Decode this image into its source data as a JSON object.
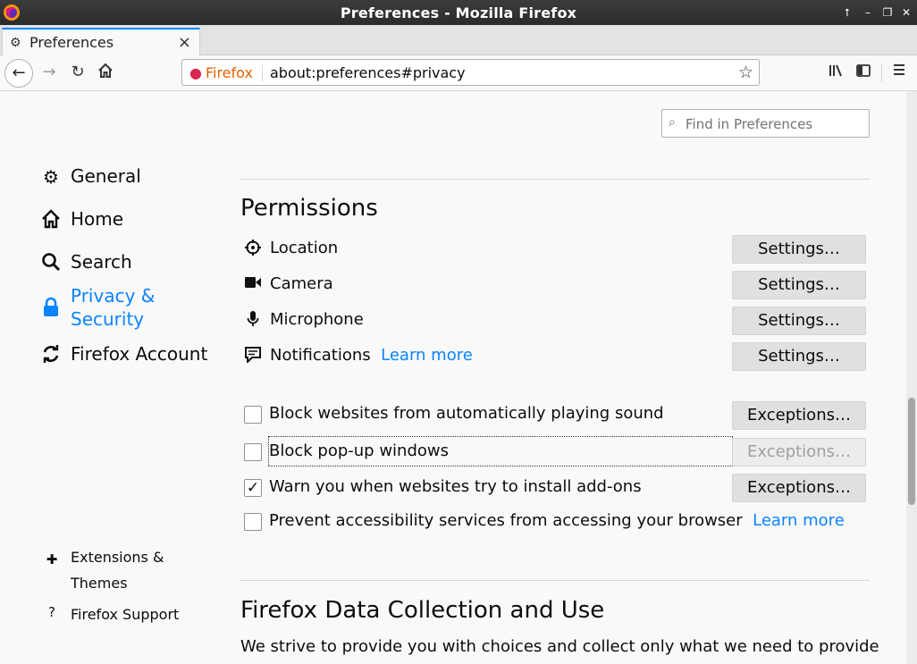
{
  "window": {
    "title": "Preferences - Mozilla Firefox"
  },
  "tabs": [
    {
      "label": "Preferences"
    }
  ],
  "toolbar": {
    "identity": "Firefox",
    "url": "about:preferences#privacy"
  },
  "search": {
    "placeholder": "Find in Preferences"
  },
  "sidebar": {
    "categories": [
      {
        "label": "General",
        "icon": "gear-icon"
      },
      {
        "label": "Home",
        "icon": "home-icon"
      },
      {
        "label": "Search",
        "icon": "search-icon"
      },
      {
        "label": "Privacy & Security",
        "icon": "lock-icon",
        "selected": true
      },
      {
        "label": "Firefox Account",
        "icon": "sync-icon"
      }
    ],
    "footer": [
      {
        "label": "Extensions & Themes",
        "icon": "puzzle-icon"
      },
      {
        "label": "Firefox Support",
        "icon": "help-icon"
      }
    ]
  },
  "permissions": {
    "heading": "Permissions",
    "items": [
      {
        "label": "Location",
        "icon": "location-icon",
        "button": "Settings…"
      },
      {
        "label": "Camera",
        "icon": "camera-icon",
        "button": "Settings…"
      },
      {
        "label": "Microphone",
        "icon": "microphone-icon",
        "button": "Settings…"
      },
      {
        "label": "Notifications",
        "icon": "notification-icon",
        "learn_more": "Learn more",
        "button": "Settings…"
      }
    ],
    "checkboxes": [
      {
        "label": "Block websites from automatically playing sound",
        "checked": false,
        "button": "Exceptions…",
        "button_enabled": true
      },
      {
        "label": "Block pop-up windows",
        "checked": false,
        "button": "Exceptions…",
        "button_enabled": false
      },
      {
        "label": "Warn you when websites try to install add-ons",
        "checked": true,
        "button": "Exceptions…",
        "button_enabled": true
      },
      {
        "label": "Prevent accessibility services from accessing your browser",
        "checked": false,
        "learn_more": "Learn more"
      }
    ]
  },
  "data_collection": {
    "heading": "Firefox Data Collection and Use",
    "intro": "We strive to provide you with choices and collect only what we need to provide"
  },
  "colors": {
    "accent": "#0a84ff",
    "link": "#0a84ff"
  }
}
